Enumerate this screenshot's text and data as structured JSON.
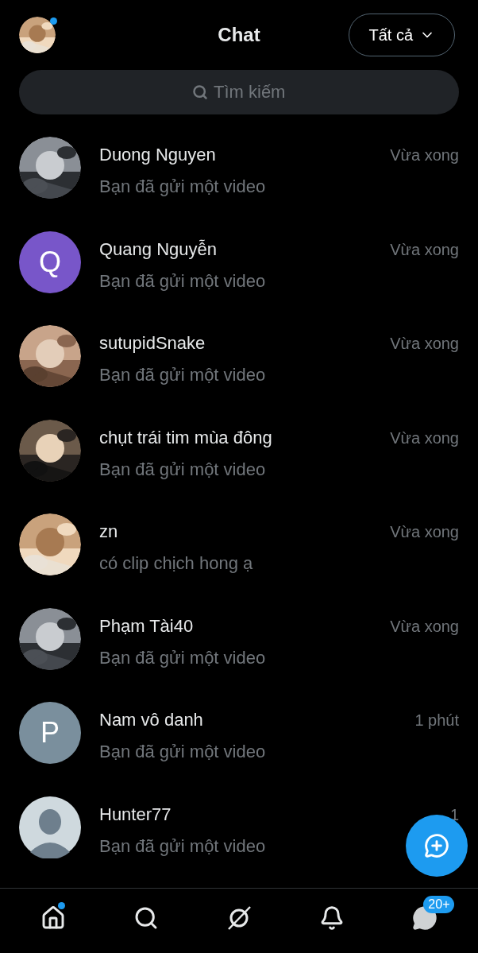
{
  "header": {
    "title": "Chat",
    "filter": {
      "label": "Tất cả"
    },
    "profile_dot": true
  },
  "search": {
    "placeholder": "Tìm kiếm"
  },
  "conversations": [
    {
      "name": "Duong Nguyen",
      "preview": "Bạn đã gửi một video",
      "time": "Vừa xong"
    },
    {
      "name": "Quang Nguyễn",
      "preview": "Bạn đã gửi một video",
      "time": "Vừa xong",
      "avatar": {
        "kind": "letter",
        "letter": "Q",
        "color": "#7856c9"
      }
    },
    {
      "name": "sutupidSnake",
      "preview": "Bạn đã gửi một video",
      "time": "Vừa xong"
    },
    {
      "name": "chụt trái tim mùa đông",
      "preview": "Bạn đã gửi một video",
      "time": "Vừa xong"
    },
    {
      "name": "zn",
      "preview": "có clip chịch hong ạ",
      "time": "Vừa xong"
    },
    {
      "name": "Phạm Tài40",
      "preview": "Bạn đã gửi một video",
      "time": "Vừa xong"
    },
    {
      "name": "Nam vô danh",
      "preview": "Bạn đã gửi một video",
      "time": "1 phút",
      "avatar": {
        "kind": "letter",
        "letter": "P",
        "color": "#7a8f9d"
      }
    },
    {
      "name": "Hunter77",
      "preview": "Bạn đã gửi một video",
      "time": "1",
      "avatar": {
        "kind": "default"
      }
    }
  ],
  "nav": [
    {
      "kind": "home",
      "dot": true
    },
    {
      "kind": "search",
      "dot": false
    },
    {
      "kind": "grok",
      "dot": false
    },
    {
      "kind": "bell",
      "dot": false
    },
    {
      "kind": "messages",
      "dot": false,
      "badge": "20+"
    }
  ]
}
